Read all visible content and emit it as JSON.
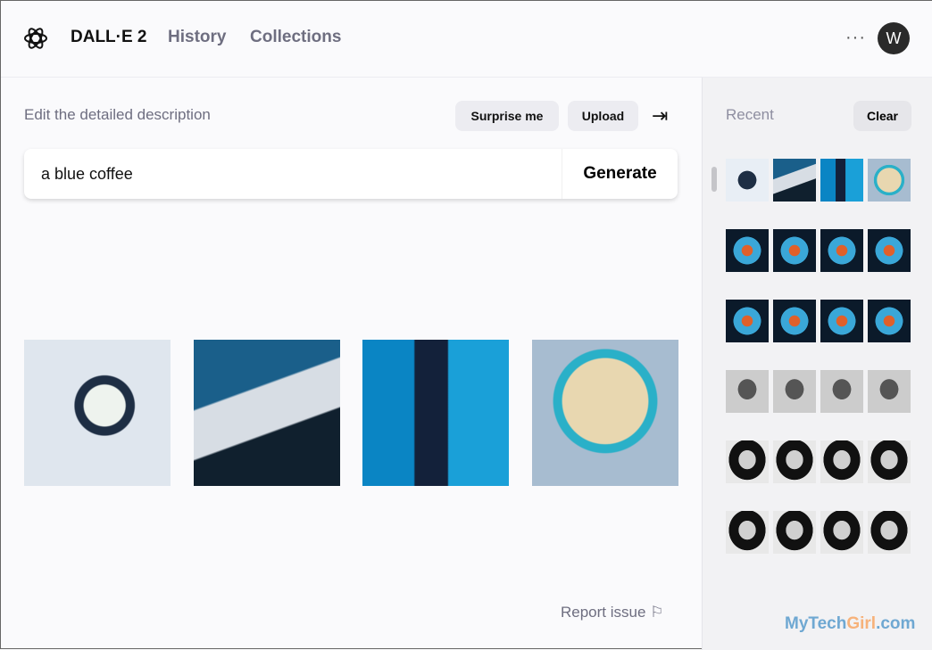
{
  "header": {
    "brand": "DALL·E 2",
    "nav": [
      "History",
      "Collections"
    ],
    "more": "···",
    "avatar": "W"
  },
  "main": {
    "label": "Edit the detailed description",
    "surprise": "Surprise me",
    "upload": "Upload",
    "collapse_icon": "arrow-right-to-bar",
    "prompt_value": "a blue coffee",
    "generate": "Generate",
    "images": [
      "coffee cup overhead",
      "latte on saucer",
      "blue takeaway cup",
      "latte art bowl"
    ],
    "report": "Report issue"
  },
  "sidebar": {
    "title": "Recent",
    "clear": "Clear",
    "rows": 6,
    "cols": 4
  },
  "watermark": {
    "a": "MyTech",
    "b": "Girl",
    ".c": ".com",
    "c": ".com"
  }
}
